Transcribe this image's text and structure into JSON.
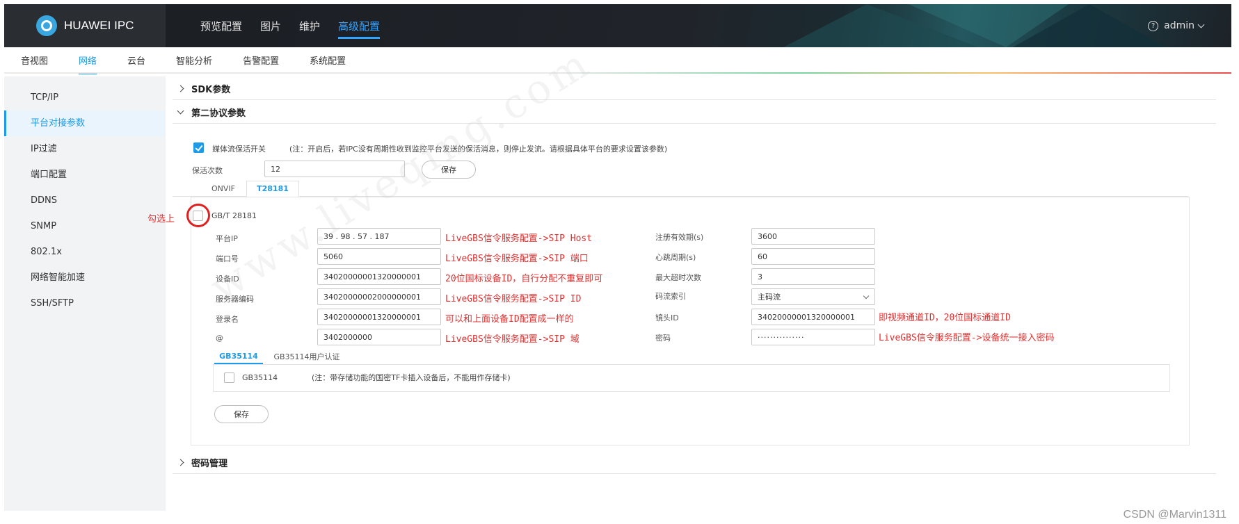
{
  "header": {
    "brand": "HUAWEI IPC",
    "nav": [
      "预览配置",
      "图片",
      "维护",
      "高级配置"
    ],
    "nav_active": 3,
    "user": "admin"
  },
  "subnav": {
    "items": [
      "音视图",
      "网络",
      "云台",
      "智能分析",
      "告警配置",
      "系统配置"
    ],
    "active": 1
  },
  "sidebar": {
    "items": [
      "TCP/IP",
      "平台对接参数",
      "IP过滤",
      "端口配置",
      "DDNS",
      "SNMP",
      "802.1x",
      "网络智能加速",
      "SSH/SFTP"
    ],
    "active": 1
  },
  "sections": {
    "sdk": "SDK参数",
    "second": "第二协议参数",
    "password": "密码管理"
  },
  "keepalive": {
    "switch_label": "媒体流保活开关",
    "note": "(注：开启后，若IPC没有周期性收到监控平台发送的保活消息，则停止发流。请根据具体平台的要求设置该参数)",
    "count_label": "保活次数",
    "count_value": "12",
    "save": "保存"
  },
  "protocol_tabs": [
    "ONVIF",
    "T28181"
  ],
  "gb": {
    "enable_label": "GB/T 28181",
    "fields_left": [
      {
        "label": "平台IP",
        "value": "39 . 98 . 57 . 187"
      },
      {
        "label": "端口号",
        "value": "5060"
      },
      {
        "label": "设备ID",
        "value": "34020000001320000001"
      },
      {
        "label": "服务器编码",
        "value": "34020000002000000001"
      },
      {
        "label": "登录名",
        "value": "34020000001320000001"
      },
      {
        "label": "@",
        "value": "3402000000"
      }
    ],
    "fields_right": [
      {
        "label": "注册有效期(s)",
        "value": "3600"
      },
      {
        "label": "心跳周期(s)",
        "value": "60"
      },
      {
        "label": "最大超时次数",
        "value": "3"
      },
      {
        "label": "码流索引",
        "value": "主码流"
      },
      {
        "label": "镜头ID",
        "value": "34020000001320000001"
      },
      {
        "label": "密码",
        "value": "···············"
      }
    ],
    "subtabs": [
      "GB35114",
      "GB35114用户认证"
    ],
    "gb35114_label": "GB35114",
    "gb35114_note": "(注：带存储功能的国密TF卡插入设备后，不能用作存储卡)",
    "save": "保存"
  },
  "annotations": {
    "check_hint": "勾选上",
    "platform_ip": "LiveGBS信令服务配置->SIP Host",
    "port": "LiveGBS信令服务配置->SIP 端口",
    "device_id": "20位国标设备ID，自行分配不重复即可",
    "server_code": "LiveGBS信令服务配置->SIP ID",
    "login": "可以和上面设备ID配置成一样的",
    "domain": "LiveGBS信令服务配置->SIP 域",
    "channel": "即视频通道ID，20位国标通道ID",
    "password": "LiveGBS信令服务配置->设备统一接入密码"
  },
  "watermark": "www.liveqing.com",
  "footer": "CSDN @Marvin1311",
  "colors": {
    "accent": "#1e9be8",
    "annotation": "#e03030",
    "topbar": "#1d2126"
  }
}
